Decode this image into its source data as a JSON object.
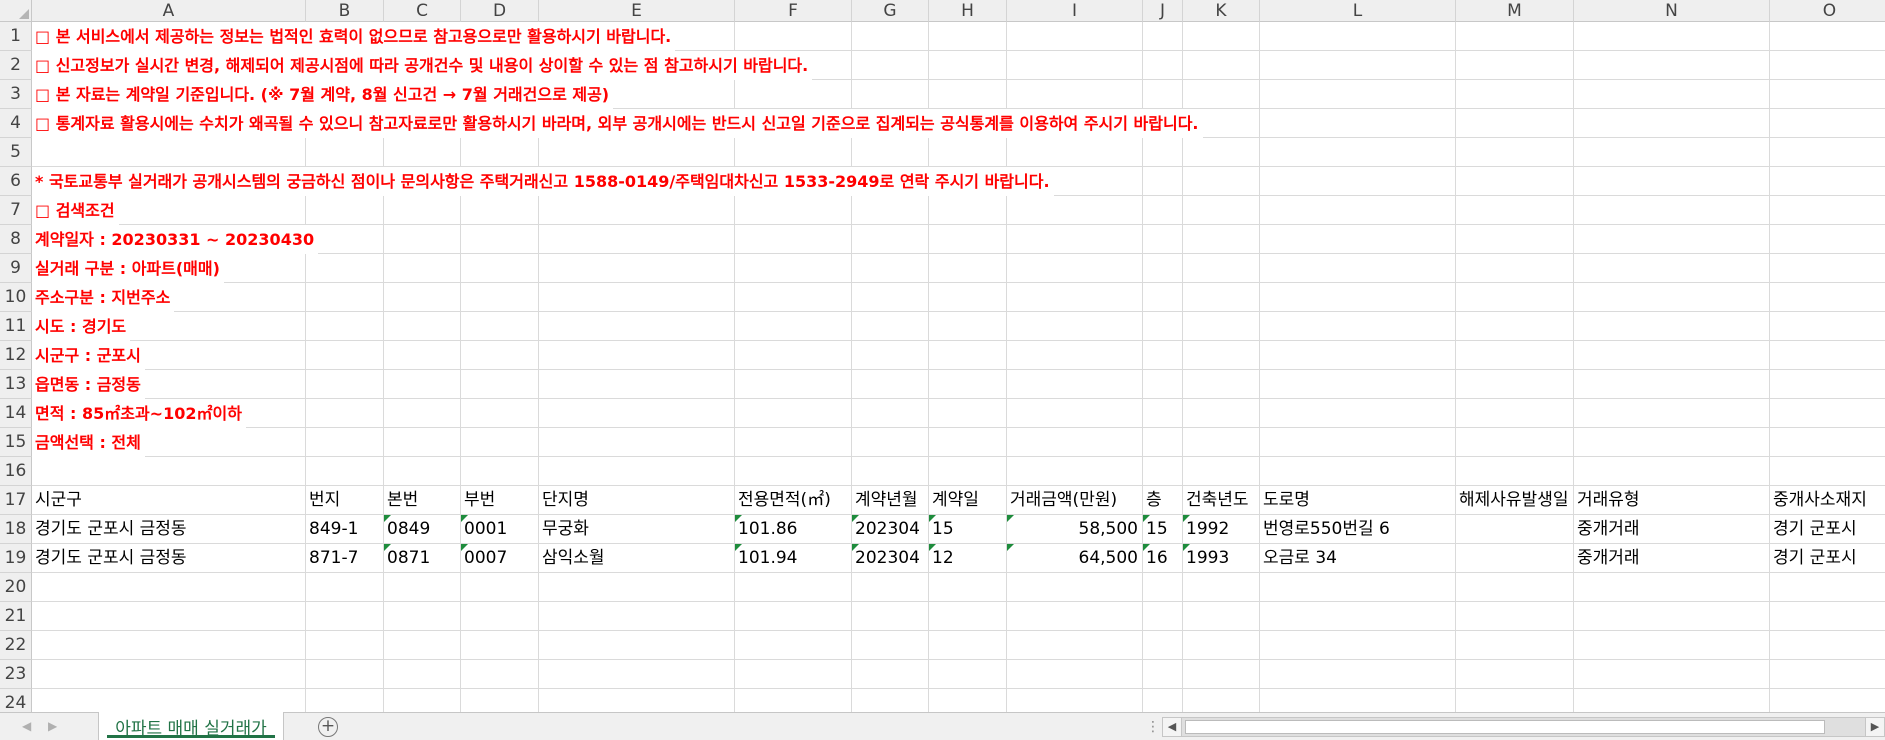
{
  "columns": [
    "A",
    "B",
    "C",
    "D",
    "E",
    "F",
    "G",
    "H",
    "I",
    "J",
    "K",
    "L",
    "M",
    "N",
    "O"
  ],
  "rows": [
    "1",
    "2",
    "3",
    "4",
    "5",
    "6",
    "7",
    "8",
    "9",
    "10",
    "11",
    "12",
    "13",
    "14",
    "15",
    "16",
    "17",
    "18",
    "19",
    "20",
    "21",
    "22",
    "23",
    "24"
  ],
  "notes": {
    "r1": "□ 본 서비스에서 제공하는 정보는 법적인 효력이 없으므로 참고용으로만 활용하시기 바랍니다.",
    "r2": "□ 신고정보가 실시간 변경, 해제되어 제공시점에 따라 공개건수 및 내용이 상이할 수 있는 점 참고하시기 바랍니다.",
    "r3": "□ 본 자료는 계약일 기준입니다. (※ 7월 계약, 8월 신고건 → 7월 거래건으로 제공)",
    "r4": "□ 통계자료 활용시에는 수치가 왜곡될 수 있으니 참고자료로만 활용하시기 바라며, 외부 공개시에는 반드시 신고일 기준으로 집계되는 공식통계를 이용하여 주시기 바랍니다.",
    "r6": "* 국토교통부 실거래가 공개시스템의 궁금하신 점이나 문의사항은 주택거래신고 1588-0149/주택임대차신고 1533-2949로 연락 주시기 바랍니다.",
    "r7": "□ 검색조건",
    "r8": "계약일자 : 20230331 ~ 20230430",
    "r9": "실거래 구분 : 아파트(매매)",
    "r10": "주소구분 : 지번주소",
    "r11": "시도 : 경기도",
    "r12": "시군구 : 군포시",
    "r13": "읍면동 : 금정동",
    "r14": "면적 : 85㎡초과~102㎡이하",
    "r15": "금액선택 : 전체"
  },
  "table": {
    "headers": [
      "시군구",
      "번지",
      "본번",
      "부번",
      "단지명",
      "전용면적(㎡)",
      "계약년월",
      "계약일",
      "거래금액(만원)",
      "층",
      "건축년도",
      "도로명",
      "해제사유발생일",
      "거래유형",
      "중개사소재지"
    ],
    "records": [
      [
        "경기도 군포시 금정동",
        "849-1",
        "0849",
        "0001",
        "무궁화",
        "101.86",
        "202304",
        "15",
        "58,500",
        "15",
        "1992",
        "번영로550번길 6",
        "",
        "중개거래",
        "경기 군포시"
      ],
      [
        "경기도 군포시 금정동",
        "871-7",
        "0871",
        "0007",
        "삼익소월",
        "101.94",
        "202304",
        "12",
        "64,500",
        "16",
        "1993",
        "오금로 34",
        "",
        "중개거래",
        "경기 군포시"
      ]
    ]
  },
  "sheet_tab": "아파트 매매 실거래가",
  "add_sheet_icon": "plus-circle-icon",
  "colors": {
    "note_text": "#ff0000",
    "tab_accent": "#217346",
    "error_marker": "#1e8c3c"
  }
}
